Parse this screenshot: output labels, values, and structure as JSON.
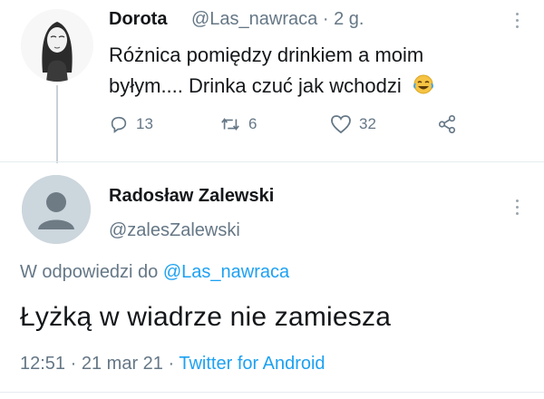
{
  "tweet1": {
    "name": "Dorota",
    "handle": "@Las_nawraca",
    "separator": "·",
    "time": "2 g.",
    "text": "Różnica pomiędzy drinkiem a moim byłym.... Drinka czuć jak wchodzi",
    "emoji": "tears-of-joy-emoji",
    "actions": {
      "reply_count": "13",
      "retweet_count": "6",
      "like_count": "32"
    }
  },
  "tweet2": {
    "name": "Radosław Zalewski",
    "handle": "@zalesZalewski",
    "replying_prefix": "W odpowiedzi do ",
    "replying_handle": "@Las_nawraca",
    "text": "Łyżką w wiadrze nie zamiesza",
    "time": "12:51",
    "date": "21 mar 21",
    "separator": "·",
    "source": "Twitter for Android"
  },
  "colors": {
    "text": "#14171a",
    "secondary": "#657786",
    "link": "#1da1f2",
    "divider": "#e6ecf0"
  }
}
